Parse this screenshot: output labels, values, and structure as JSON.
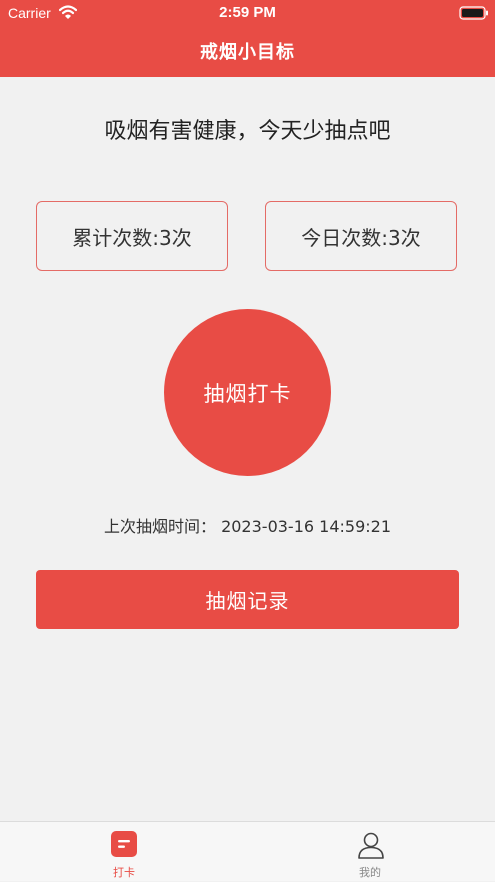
{
  "status_bar": {
    "carrier": "Carrier",
    "time": "2:59 PM",
    "wifi_icon": "wifi-icon",
    "battery_icon": "battery-icon"
  },
  "nav": {
    "title": "戒烟小目标"
  },
  "main": {
    "slogan": "吸烟有害健康，今天少抽点吧",
    "total_count": "累计次数:3次",
    "today_count": "今日次数:3次",
    "checkin_label": "抽烟打卡",
    "last_time": "上次抽烟时间：  2023-03-16 14:59:21",
    "record_label": "抽烟记录"
  },
  "tabs": [
    {
      "label": "打卡",
      "icon": "checkin-icon",
      "active": true
    },
    {
      "label": "我的",
      "icon": "user-icon",
      "active": false
    }
  ],
  "colors": {
    "brand": "#e84c45",
    "border": "#e46b66",
    "background": "#f1f1f1",
    "inactive_tab": "#888888"
  }
}
